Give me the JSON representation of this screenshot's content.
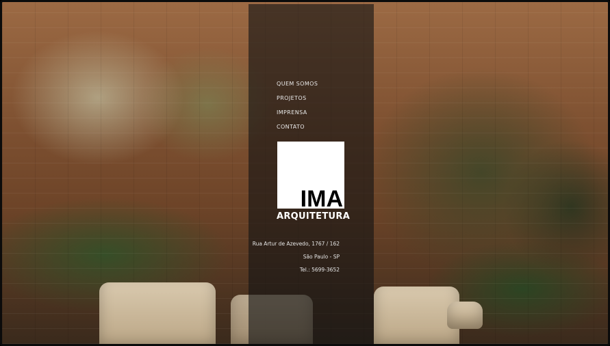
{
  "nav": {
    "items": [
      {
        "label": "QUEM SOMOS"
      },
      {
        "label": "PROJETOS"
      },
      {
        "label": "IMPRENSA"
      },
      {
        "label": "CONTATO"
      }
    ]
  },
  "logo": {
    "mark": "IMA",
    "wordmark": "ARQUITETURA"
  },
  "address": {
    "street": "Rua Artur de Azevedo, 1767 / 162",
    "city": "São Paulo - SP",
    "phone": "Tel.: 5699-3652"
  },
  "colors": {
    "panel": "#141414",
    "text": "#e9e9e9",
    "logo_bg": "#ffffff"
  }
}
